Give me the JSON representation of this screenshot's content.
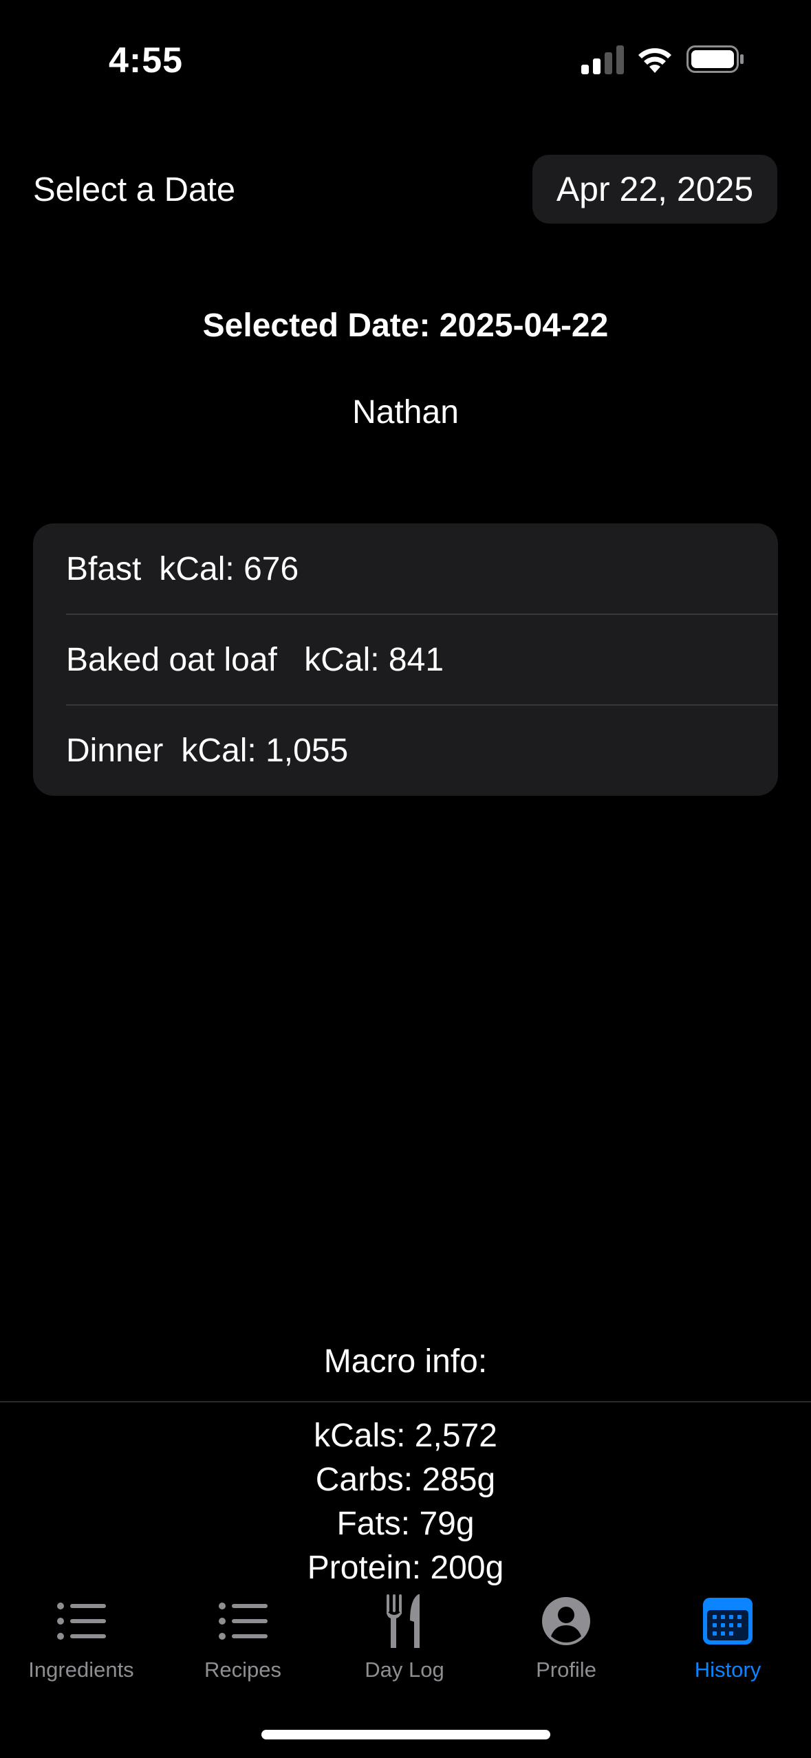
{
  "status_bar": {
    "time": "4:55"
  },
  "date_selector": {
    "label": "Select a Date",
    "value": "Apr 22, 2025"
  },
  "selected_date": "Selected Date: 2025-04-22",
  "user_name": "Nathan",
  "meals": [
    {
      "name": "Bfast",
      "kcal": "kCal: 676"
    },
    {
      "name": "Baked oat loaf ",
      "kcal": "kCal: 841"
    },
    {
      "name": "Dinner",
      "kcal": "kCal: 1,055"
    }
  ],
  "macros": {
    "title": "Macro info:",
    "kcals": "kCals: 2,572",
    "carbs": "Carbs: 285g",
    "fats": "Fats: 79g",
    "protein": "Protein: 200g"
  },
  "tabs": [
    {
      "label": "Ingredients",
      "icon": "list-icon"
    },
    {
      "label": "Recipes",
      "icon": "list-icon"
    },
    {
      "label": "Day Log",
      "icon": "fork-knife-icon"
    },
    {
      "label": "Profile",
      "icon": "person-circle-icon"
    },
    {
      "label": "History",
      "icon": "calendar-icon",
      "active": true
    }
  ],
  "colors": {
    "accent": "#0a84ff",
    "card": "#1c1c1e",
    "inactive": "#8e8e93"
  }
}
